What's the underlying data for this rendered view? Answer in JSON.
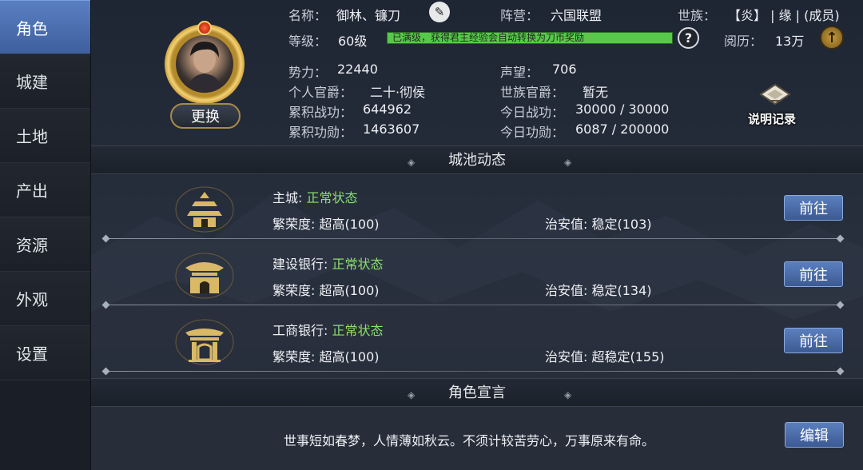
{
  "sidebar": {
    "items": [
      {
        "label": "角色",
        "active": true
      },
      {
        "label": "城建",
        "active": false
      },
      {
        "label": "土地",
        "active": false
      },
      {
        "label": "产出",
        "active": false
      },
      {
        "label": "资源",
        "active": false
      },
      {
        "label": "外观",
        "active": false
      },
      {
        "label": "设置",
        "active": false
      }
    ]
  },
  "profile": {
    "change_label": "更换",
    "name_label": "名称：",
    "name_value": "御林、镰刀",
    "camp_label": "阵营：",
    "camp_value": "六国联盟",
    "clan_label": "世族：",
    "clan_value": "【炎】 | 缘 | (成员)",
    "level_label": "等级：",
    "level_value": "60级",
    "exp_bar_text": "已满级，获得君主经验会自动转换为刀币奖励",
    "exp_fill": 1.0,
    "experience_label": "阅历：",
    "experience_value": "13万",
    "power_label": "势力：",
    "power_value": "22440",
    "reputation_label": "声望：",
    "reputation_value": "706",
    "personal_rank_label": "个人官爵：",
    "personal_rank_value": "二十·彻侯",
    "clan_rank_label": "世族官爵：",
    "clan_rank_value": "暂无",
    "total_merit_label": "累积战功：",
    "total_merit_value": "644962",
    "today_merit_label": "今日战功：",
    "today_merit_value": "30000 / 30000",
    "total_service_label": "累积功勋：",
    "total_service_value": "1463607",
    "today_service_label": "今日功勋：",
    "today_service_value": "6087 / 200000",
    "record_label": "说明记录"
  },
  "city_section": {
    "title": "城池动态",
    "rows": [
      {
        "name": "主城: ",
        "status": "正常状态",
        "prosperity": "繁荣度:  超高(100)",
        "order": "治安值:   稳定(103)",
        "button": "前往"
      },
      {
        "name": "建设银行: ",
        "status": "正常状态",
        "prosperity": "繁荣度:  超高(100)",
        "order": "治安值:   稳定(134)",
        "button": "前往"
      },
      {
        "name": "工商银行: ",
        "status": "正常状态",
        "prosperity": "繁荣度:  超高(100)",
        "order": "治安值:   超稳定(155)",
        "button": "前往"
      }
    ]
  },
  "motto_section": {
    "title": "角色宣言",
    "text": "世事短如春梦，人情薄如秋云。不须计较苦劳心，万事原来有命。",
    "edit_label": "编辑"
  },
  "colors": {
    "status_green": "#8be06b",
    "exp_bar": "#57c94a",
    "active_tab": "#4a6cad",
    "button_blue": "#4a6cad"
  }
}
